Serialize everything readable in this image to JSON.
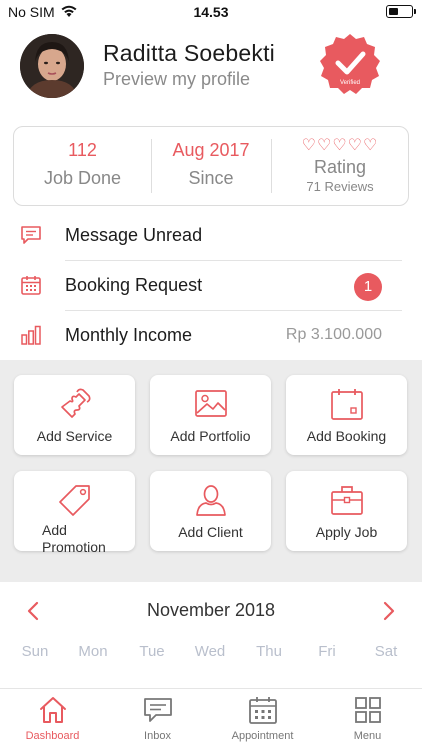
{
  "status_bar": {
    "carrier": "No SIM",
    "time": "14.53"
  },
  "profile": {
    "name": "Raditta Soebekti",
    "subtitle": "Preview my profile",
    "verified_label": "Verified"
  },
  "stats": {
    "jobs": {
      "value": "112",
      "label": "Job Done"
    },
    "since": {
      "value": "Aug 2017",
      "label": "Since"
    },
    "rating": {
      "hearts": "♡♡♡♡♡",
      "label": "Rating",
      "reviews": "71 Reviews"
    }
  },
  "info_list": [
    {
      "label": "Message Unread",
      "icon": "message-icon"
    },
    {
      "label": "Booking Request",
      "icon": "calendar-icon",
      "badge": "1"
    },
    {
      "label": "Monthly Income",
      "icon": "bar-chart-icon",
      "value": "Rp 3.100.000"
    }
  ],
  "actions": [
    {
      "label": "Add Service",
      "icon": "puzzle-icon"
    },
    {
      "label": "Add Portfolio",
      "icon": "image-icon"
    },
    {
      "label": "Add Booking",
      "icon": "calendar-icon"
    },
    {
      "label": "Add\nPromotion",
      "icon": "tag-icon"
    },
    {
      "label": "Add Client",
      "icon": "user-icon"
    },
    {
      "label": "Apply Job",
      "icon": "briefcase-icon"
    }
  ],
  "calendar": {
    "month": "November 2018",
    "weekdays": [
      "Sun",
      "Mon",
      "Tue",
      "Wed",
      "Thu",
      "Fri",
      "Sat"
    ]
  },
  "tabs": [
    {
      "label": "Dashboard",
      "icon": "home-icon",
      "active": true
    },
    {
      "label": "Inbox",
      "icon": "inbox-icon",
      "active": false
    },
    {
      "label": "Appointment",
      "icon": "calendar-icon",
      "active": false
    },
    {
      "label": "Menu",
      "icon": "grid-icon",
      "active": false
    }
  ],
  "colors": {
    "accent": "#e85a5f",
    "muted": "#888888",
    "grid_bg": "#ececec"
  }
}
